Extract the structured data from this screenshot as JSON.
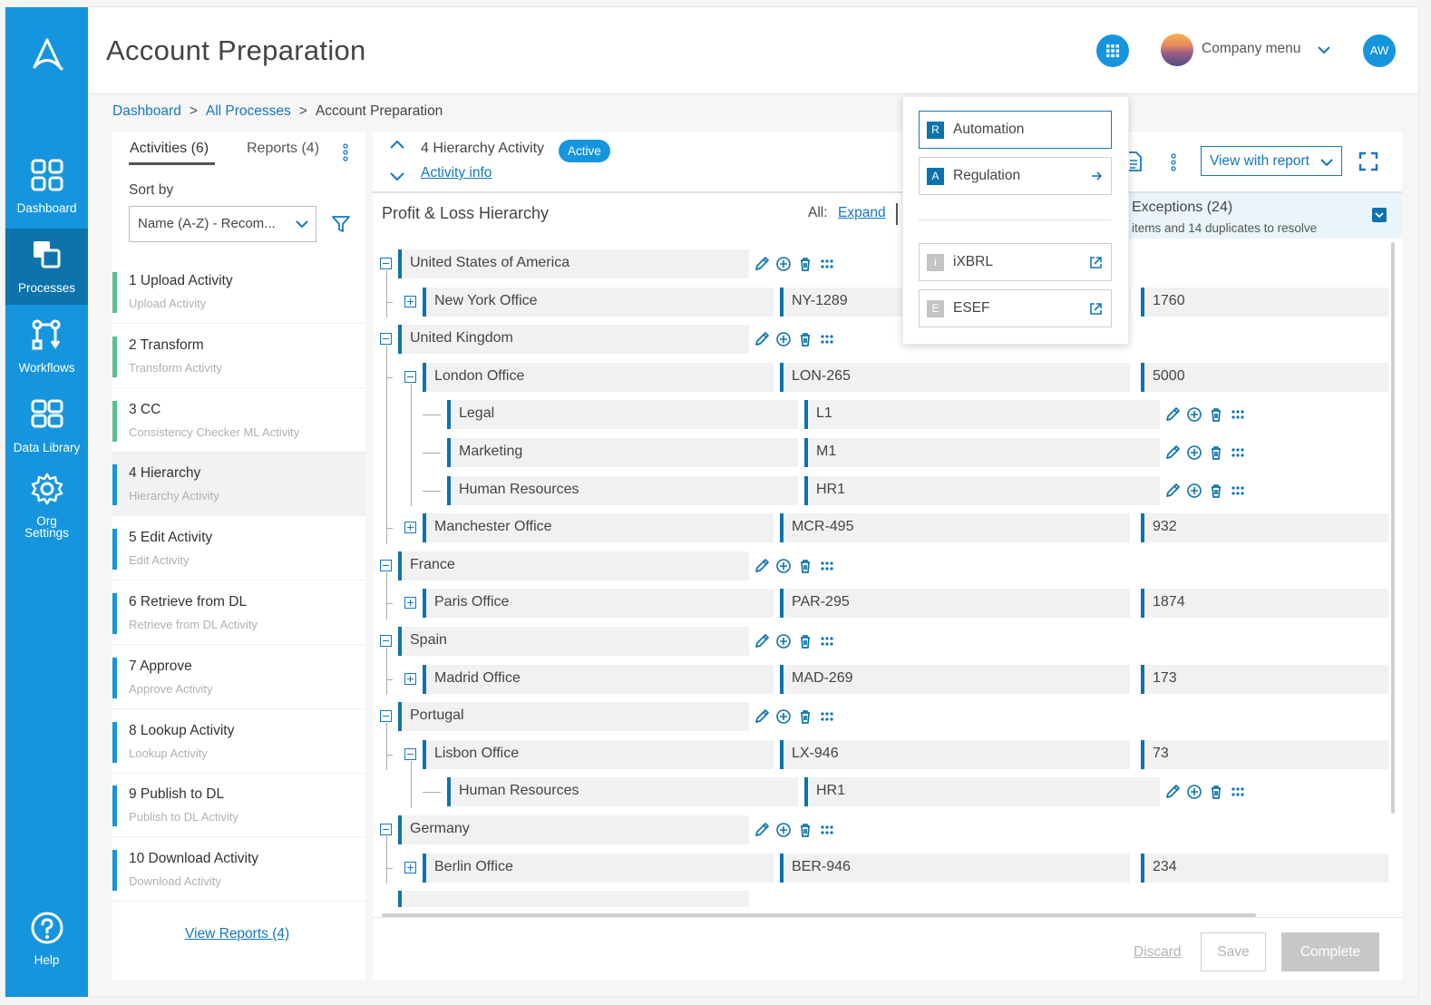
{
  "app": {
    "title": "Account Preparation",
    "company_menu": "Company menu",
    "user_initials": "AW"
  },
  "sidebar": {
    "items": [
      {
        "label": "Dashboard",
        "icon": "dashboard-icon"
      },
      {
        "label": "Processes",
        "icon": "processes-icon",
        "active": true
      },
      {
        "label": "Workflows",
        "icon": "workflows-icon"
      },
      {
        "label": "Data Library",
        "icon": "data-library-icon"
      },
      {
        "label": "Org Settings",
        "icon": "gear-icon"
      }
    ],
    "help": "Help"
  },
  "breadcrumb": [
    "Dashboard",
    "All Processes",
    "Account Preparation"
  ],
  "breadcrumb_sep": ">",
  "left_panel": {
    "tabs": [
      "Activities (6)",
      "Reports (4)"
    ],
    "sort_label": "Sort by",
    "sort_value": "Name (A-Z) - Recom...",
    "activities": [
      {
        "title": "1 Upload Activity",
        "subtitle": "Upload Activity",
        "status": "done"
      },
      {
        "title": "2 Transform",
        "subtitle": "Transform Activity",
        "status": "done"
      },
      {
        "title": "3 CC",
        "subtitle": "Consistency Checker ML Activity",
        "status": "done"
      },
      {
        "title": "4 Hierarchy",
        "subtitle": "Hierarchy Activity",
        "status": "active"
      },
      {
        "title": "5 Edit Activity",
        "subtitle": "Edit Activity",
        "status": "pending"
      },
      {
        "title": "6 Retrieve from DL",
        "subtitle": "Retrieve from DL Activity",
        "status": "pending"
      },
      {
        "title": "7 Approve",
        "subtitle": "Approve Activity",
        "status": "pending"
      },
      {
        "title": "8 Lookup Activity",
        "subtitle": "Lookup Activity",
        "status": "pending"
      },
      {
        "title": "9 Publish to DL",
        "subtitle": "Publish to DL  Activity",
        "status": "pending"
      },
      {
        "title": "10 Download Activity",
        "subtitle": "Download Activity",
        "status": "pending"
      }
    ],
    "view_reports": "View Reports (4)"
  },
  "main": {
    "activity_title": "4 Hierarchy Activity",
    "status": "Active",
    "activity_info": "Activity info",
    "view_with_report": "View with report",
    "hierarchy_title": "Profit & Loss Hierarchy",
    "all_label": "All:",
    "expand": "Expand",
    "exceptions_title": "Exceptions (24)",
    "exceptions_sub": "items and 14 duplicates to resolve",
    "tree": [
      {
        "level": 0,
        "name": "United States of America",
        "toggle": "minus",
        "actions": true
      },
      {
        "level": 1,
        "name": "New York Office",
        "toggle": "plus",
        "code": "NY-1289",
        "value": "1760"
      },
      {
        "level": 0,
        "name": "United Kingdom",
        "toggle": "minus",
        "actions": true
      },
      {
        "level": 1,
        "name": "London Office",
        "toggle": "minus",
        "code": "LON-265",
        "value": "5000"
      },
      {
        "level": 2,
        "name": "Legal",
        "code": "L1",
        "actions": true
      },
      {
        "level": 2,
        "name": "Marketing",
        "code": "M1",
        "actions": true
      },
      {
        "level": 2,
        "name": "Human Resources",
        "code": "HR1",
        "actions": true
      },
      {
        "level": 1,
        "name": "Manchester Office",
        "toggle": "plus",
        "code": "MCR-495",
        "value": "932"
      },
      {
        "level": 0,
        "name": "France",
        "toggle": "minus",
        "actions": true
      },
      {
        "level": 1,
        "name": "Paris Office",
        "toggle": "plus",
        "code": "PAR-295",
        "value": "1874"
      },
      {
        "level": 0,
        "name": "Spain",
        "toggle": "minus",
        "actions": true
      },
      {
        "level": 1,
        "name": "Madrid Office",
        "toggle": "plus",
        "code": "MAD-269",
        "value": "173"
      },
      {
        "level": 0,
        "name": "Portugal",
        "toggle": "minus",
        "actions": true
      },
      {
        "level": 1,
        "name": "Lisbon Office",
        "toggle": "minus",
        "code": "LX-946",
        "value": "73"
      },
      {
        "level": 2,
        "name": "Human Resources",
        "code": "HR1",
        "actions": true
      },
      {
        "level": 0,
        "name": "Germany",
        "toggle": "minus",
        "actions": true
      },
      {
        "level": 1,
        "name": "Berlin Office",
        "toggle": "plus",
        "code": "BER-946",
        "value": "234"
      },
      {
        "level": 0,
        "name": ""
      }
    ],
    "footer": {
      "discard": "Discard",
      "save": "Save",
      "complete": "Complete"
    }
  },
  "dropdown": {
    "items": [
      {
        "badge": "R",
        "label": "Automation",
        "selected": true
      },
      {
        "badge": "A",
        "label": "Regulation",
        "icon": "arrow-right-icon"
      },
      {
        "badge": "i",
        "label": "iXBRL",
        "icon": "external-link-icon",
        "grey": true
      },
      {
        "badge": "E",
        "label": "ESEF",
        "icon": "external-link-icon",
        "grey": true
      }
    ]
  },
  "colors": {
    "brand": "#1595dd",
    "brand_dark": "#0c73ad",
    "link": "#1477c0",
    "done": "#55c28a"
  }
}
